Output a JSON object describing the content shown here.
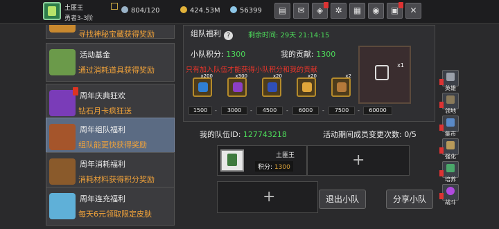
{
  "player": {
    "name": "土匪王",
    "title": "勇者3-3阶"
  },
  "stats": {
    "energy": "804/120",
    "gold": "424.53M",
    "gems": "56399"
  },
  "toolbar_icons": [
    "shop-icon",
    "mail-icon",
    "quest-icon",
    "settings-icon",
    "gift-icon",
    "wheel-icon",
    "chest-icon",
    "tools-icon"
  ],
  "events": [
    {
      "title": "",
      "sub": "寻找神秘宝藏获得奖励",
      "icon": "treasure-icon",
      "color": "#c9892f"
    },
    {
      "title": "活动基金",
      "sub": "通过消耗道具获得奖励",
      "icon": "money-bag-icon",
      "color": "#6b9a4a"
    },
    {
      "title": "周年庆典狂欢",
      "sub": "钻石月卡疯狂送",
      "icon": "purple-crystal-icon",
      "color": "#7a3cb8"
    },
    {
      "title": "周年组队福利",
      "sub": "组队能更快获得奖励",
      "icon": "treasure-chest-icon",
      "color": "#a5552b"
    },
    {
      "title": "周年消耗福利",
      "sub": "消耗材料获得积分奖励",
      "icon": "wood-chest-icon",
      "color": "#8a5a2b"
    },
    {
      "title": "周年连充福利",
      "sub": "每天6元领取限定皮肤",
      "icon": "ice-crystal-icon",
      "color": "#5fb0d8"
    }
  ],
  "team_event": {
    "title": "组队福利",
    "countdown_label": "剩余时间:",
    "countdown": "29天 21:14:15",
    "team_score_label": "小队积分:",
    "team_score": "1300",
    "my_contrib_label": "我的贡献:",
    "my_contrib": "1300",
    "notice": "只有加入队伍才能获得小队积分和我的贡献",
    "rewards": [
      {
        "count": "x200",
        "icon": "lightning-scroll-icon",
        "color": "#2f7fd4"
      },
      {
        "count": "x300",
        "icon": "purple-potion-icon",
        "color": "#8c3fc4"
      },
      {
        "count": "x20",
        "icon": "blue-gem-icon",
        "color": "#2f4fb8"
      },
      {
        "count": "x20",
        "icon": "golden-egg-icon",
        "color": "#e0a63a"
      },
      {
        "count": "x2",
        "icon": "scroll-icon",
        "color": "#b57a3a"
      }
    ],
    "thresholds": [
      "1500",
      "3000",
      "4500",
      "6000",
      "7500",
      "60000"
    ],
    "big_reward_count": "x1"
  },
  "team": {
    "id_label": "我的队伍ID:",
    "id": "127743218",
    "changes_label": "活动期间成员变更次数:",
    "changes": "0/5",
    "member_name": "土匪王",
    "member_score_label": "积分:",
    "member_score": "1300",
    "leave_label": "退出小队",
    "share_label": "分享小队"
  },
  "sidebar": [
    {
      "label": "英雄",
      "icon": "hero-icon",
      "color": "#9aa0aa"
    },
    {
      "label": "领地",
      "icon": "castle-icon",
      "color": "#8a7a5a"
    },
    {
      "label": "集市",
      "icon": "market-icon",
      "color": "#5a8ac8"
    },
    {
      "label": "强化",
      "icon": "anvil-icon",
      "color": "#b89a5a"
    },
    {
      "label": "培养",
      "icon": "training-icon",
      "color": "#4aa86a"
    },
    {
      "label": "战斗",
      "icon": "portal-icon",
      "color": "#b04ae0"
    }
  ]
}
